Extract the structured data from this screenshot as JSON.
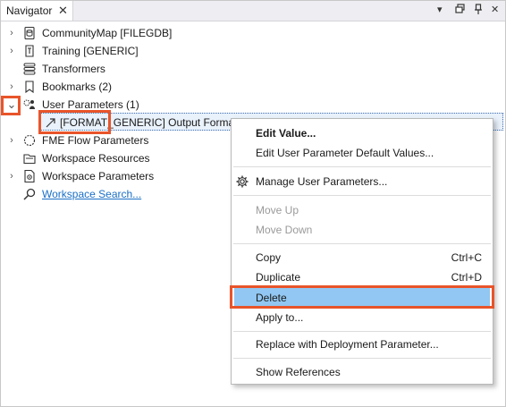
{
  "panel": {
    "title": "Navigator",
    "close_glyph": "✕",
    "controls": [
      "▾",
      "▣",
      "📌",
      "✕"
    ]
  },
  "tree": {
    "items": [
      {
        "label": "CommunityMap [FILEGDB]",
        "icon": "database-icon",
        "expander": "›"
      },
      {
        "label": "Training [GENERIC]",
        "icon": "writer-icon",
        "expander": "›"
      },
      {
        "label": "Transformers",
        "icon": "stack-icon",
        "expander": ""
      },
      {
        "label": "Bookmarks (2)",
        "icon": "bookmark-icon",
        "expander": "›"
      },
      {
        "label": "User Parameters (1)",
        "icon": "user-parameters-icon",
        "expander": "⌄"
      },
      {
        "label": "[FORMAT_GENERIC] Output Format: AUTOCAD",
        "icon": "parameter-link-icon",
        "expander": ""
      },
      {
        "label": "FME Flow Parameters",
        "icon": "flow-icon",
        "expander": "›"
      },
      {
        "label": "Workspace Resources",
        "icon": "resources-icon",
        "expander": ""
      },
      {
        "label": "Workspace Parameters",
        "icon": "workspace-parameters-icon",
        "expander": "›"
      },
      {
        "label": "Workspace Search...",
        "icon": "search-icon",
        "expander": ""
      }
    ]
  },
  "context_menu": {
    "items": [
      {
        "label": "Edit Value...",
        "shortcut": "",
        "state": "bold"
      },
      {
        "label": "Edit User Parameter Default Values...",
        "shortcut": "",
        "state": "normal"
      },
      {
        "label": "Manage User Parameters...",
        "shortcut": "",
        "state": "normal",
        "icon": "gear-icon"
      },
      {
        "label": "Move Up",
        "shortcut": "",
        "state": "disabled"
      },
      {
        "label": "Move Down",
        "shortcut": "",
        "state": "disabled"
      },
      {
        "label": "Copy",
        "shortcut": "Ctrl+C",
        "state": "normal"
      },
      {
        "label": "Duplicate",
        "shortcut": "Ctrl+D",
        "state": "normal"
      },
      {
        "label": "Delete",
        "shortcut": "",
        "state": "active"
      },
      {
        "label": "Apply to...",
        "shortcut": "",
        "state": "normal"
      },
      {
        "label": "Replace with Deployment Parameter...",
        "shortcut": "",
        "state": "normal"
      },
      {
        "label": "Show References",
        "shortcut": "",
        "state": "normal"
      }
    ]
  },
  "colors": {
    "highlight_outline": "#e8542a",
    "menu_active": "#91c7f2",
    "link": "#1a6fc7"
  }
}
